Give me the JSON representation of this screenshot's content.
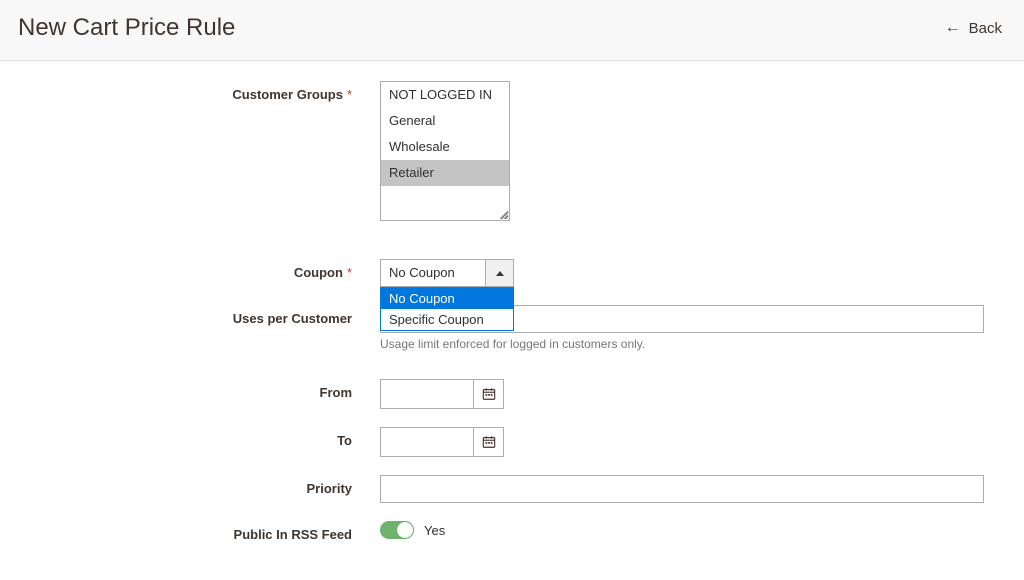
{
  "header": {
    "title": "New Cart Price Rule",
    "back_label": "Back"
  },
  "fields": {
    "customer_groups": {
      "label": "Customer Groups",
      "required": true,
      "options": [
        "NOT LOGGED IN",
        "General",
        "Wholesale",
        "Retailer"
      ],
      "selected": [
        "Retailer"
      ]
    },
    "coupon": {
      "label": "Coupon",
      "required": true,
      "value": "No Coupon",
      "options": [
        "No Coupon",
        "Specific Coupon"
      ],
      "open": true
    },
    "uses_per_customer": {
      "label": "Uses per Customer",
      "value": "",
      "hint": "Usage limit enforced for logged in customers only."
    },
    "from": {
      "label": "From",
      "value": ""
    },
    "to": {
      "label": "To",
      "value": ""
    },
    "priority": {
      "label": "Priority",
      "value": ""
    },
    "public_rss": {
      "label": "Public In RSS Feed",
      "state_label": "Yes",
      "on": true
    }
  }
}
